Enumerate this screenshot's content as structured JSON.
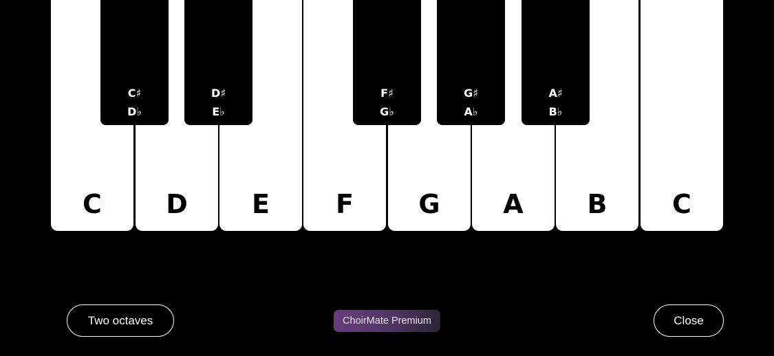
{
  "keyboard": {
    "white_keys": [
      "C",
      "D",
      "E",
      "F",
      "G",
      "A",
      "B",
      "C"
    ],
    "black_keys": [
      {
        "sharp": "C♯",
        "flat": "D♭"
      },
      {
        "sharp": "D♯",
        "flat": "E♭"
      },
      {
        "sharp": "F♯",
        "flat": "G♭"
      },
      {
        "sharp": "G♯",
        "flat": "A♭"
      },
      {
        "sharp": "A♯",
        "flat": "B♭"
      }
    ]
  },
  "footer": {
    "octave_button_label": "Two octaves",
    "premium_label": "ChoirMate Premium",
    "close_label": "Close"
  },
  "colors": {
    "background": "#000000",
    "white_key": "#ffffff",
    "black_key": "#000000",
    "premium_gradient_start": "#6a3c7c",
    "premium_gradient_end": "#2a2434"
  }
}
